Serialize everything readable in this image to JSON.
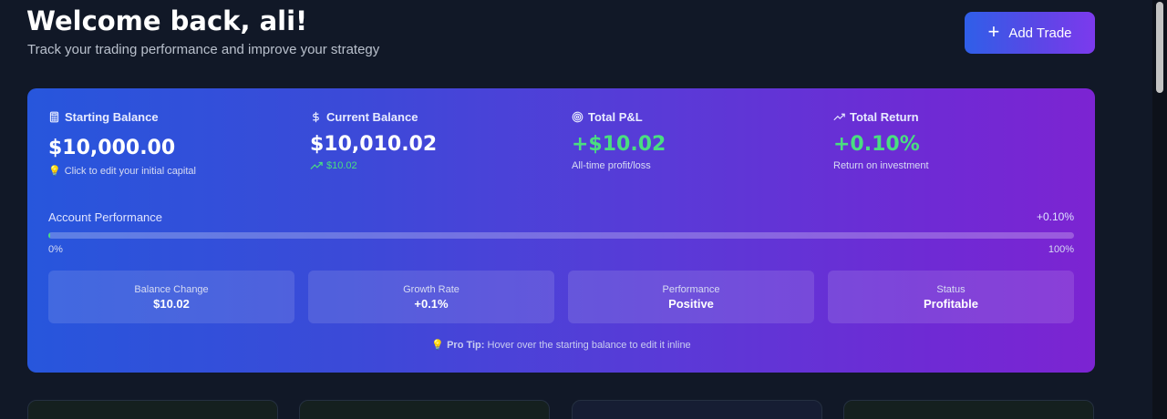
{
  "header": {
    "title": "Welcome back, ali!",
    "subtitle": "Track your trading performance and improve your strategy",
    "add_trade_label": "Add Trade"
  },
  "balance_card": {
    "starting": {
      "label": "Starting Balance",
      "value": "$10,000.00",
      "hint": "Click to edit your initial capital"
    },
    "current": {
      "label": "Current Balance",
      "value": "$10,010.02",
      "change": "$10.02"
    },
    "pnl": {
      "label": "Total P&L",
      "value": "+$10.02",
      "sub": "All-time profit/loss"
    },
    "return": {
      "label": "Total Return",
      "value": "+0.10%",
      "sub": "Return on investment"
    },
    "performance": {
      "label": "Account Performance",
      "value_text": "+0.10%",
      "progress_percent": 0.1,
      "scale_min": "0%",
      "scale_max": "100%"
    },
    "mini_stats": [
      {
        "label": "Balance Change",
        "value": "$10.02"
      },
      {
        "label": "Growth Rate",
        "value": "+0.1%"
      },
      {
        "label": "Performance",
        "value": "Positive"
      },
      {
        "label": "Status",
        "value": "Profitable"
      }
    ],
    "pro_tip": {
      "prefix": "Pro Tip:",
      "text": " Hover over the starting balance to edit it inline"
    }
  },
  "colors": {
    "background": "#111827",
    "accent_start": "#2756dc",
    "accent_end": "#7c24d2",
    "positive": "#4ade80"
  }
}
